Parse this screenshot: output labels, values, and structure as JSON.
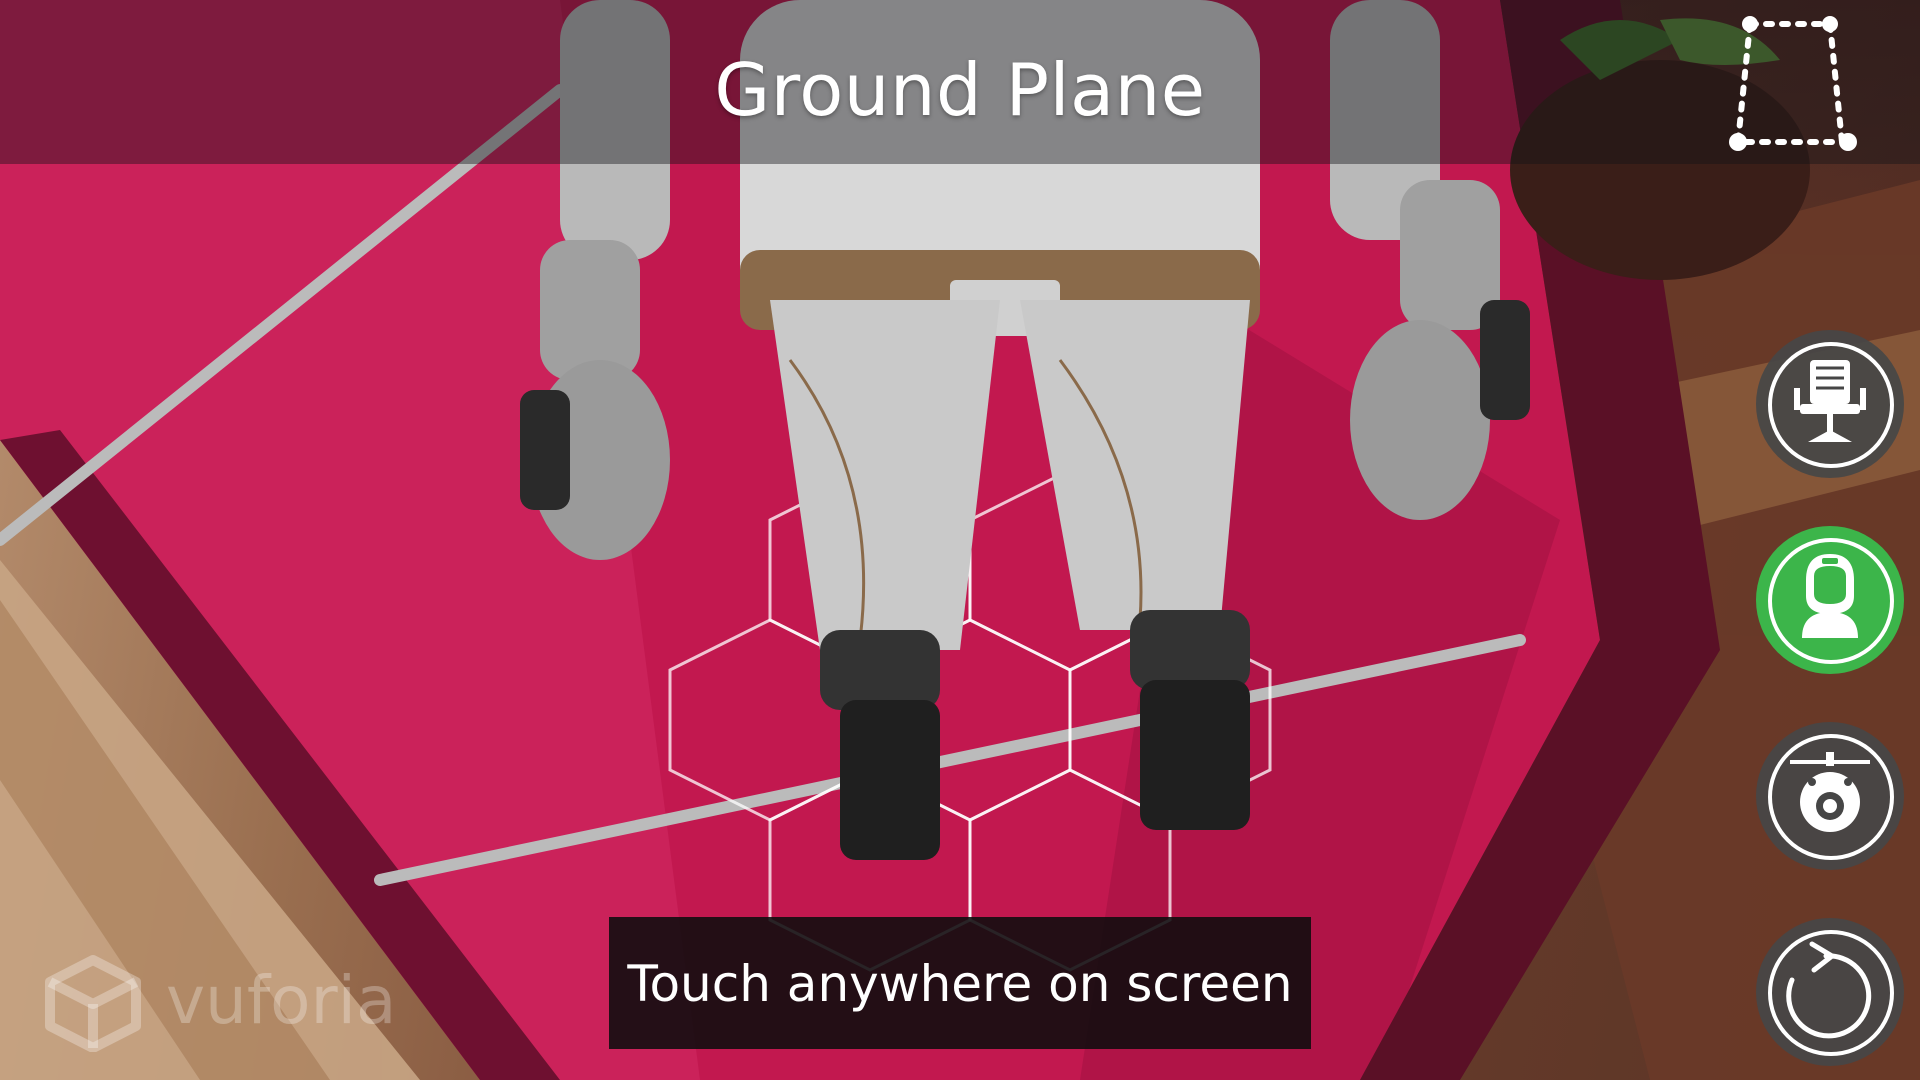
{
  "header": {
    "title": "Ground Plane",
    "reset_plane_icon": "dashed-plane-corners-icon"
  },
  "side_buttons": [
    {
      "icon": "chair-icon",
      "state": "inactive"
    },
    {
      "icon": "astronaut-icon",
      "state": "active"
    },
    {
      "icon": "drone-icon",
      "state": "inactive"
    },
    {
      "icon": "reset-rotate-icon",
      "state": "inactive"
    }
  ],
  "hint": {
    "text": "Touch anywhere on screen"
  },
  "watermark": {
    "brand": "vuforia",
    "logo_icon": "vuforia-cube-icon"
  },
  "colors": {
    "active_button": "#3cb54a",
    "inactive_button": "#464646",
    "carpet": "#c2184f",
    "title_bar": "#141418"
  }
}
